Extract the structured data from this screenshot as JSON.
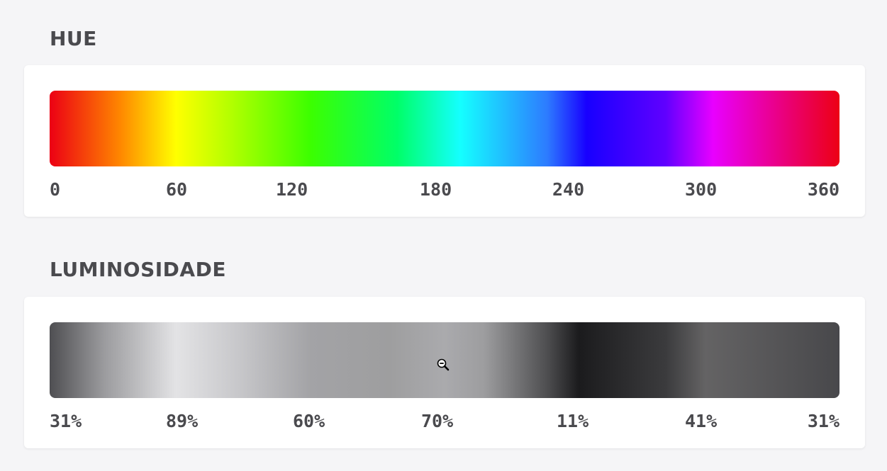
{
  "hue_section": {
    "title": "HUE",
    "ticks": [
      "0",
      "60",
      "120",
      "180",
      "240",
      "300",
      "360"
    ]
  },
  "luminosity_section": {
    "title": "LUMINOSIDADE",
    "ticks": [
      "31%",
      "89%",
      "60%",
      "70%",
      "11%",
      "41%",
      "31%"
    ]
  },
  "cursor": {
    "icon": "zoom-out-icon"
  },
  "colors": {
    "background": "#f5f5f7",
    "card": "#ffffff",
    "text": "#4a4a4e"
  }
}
